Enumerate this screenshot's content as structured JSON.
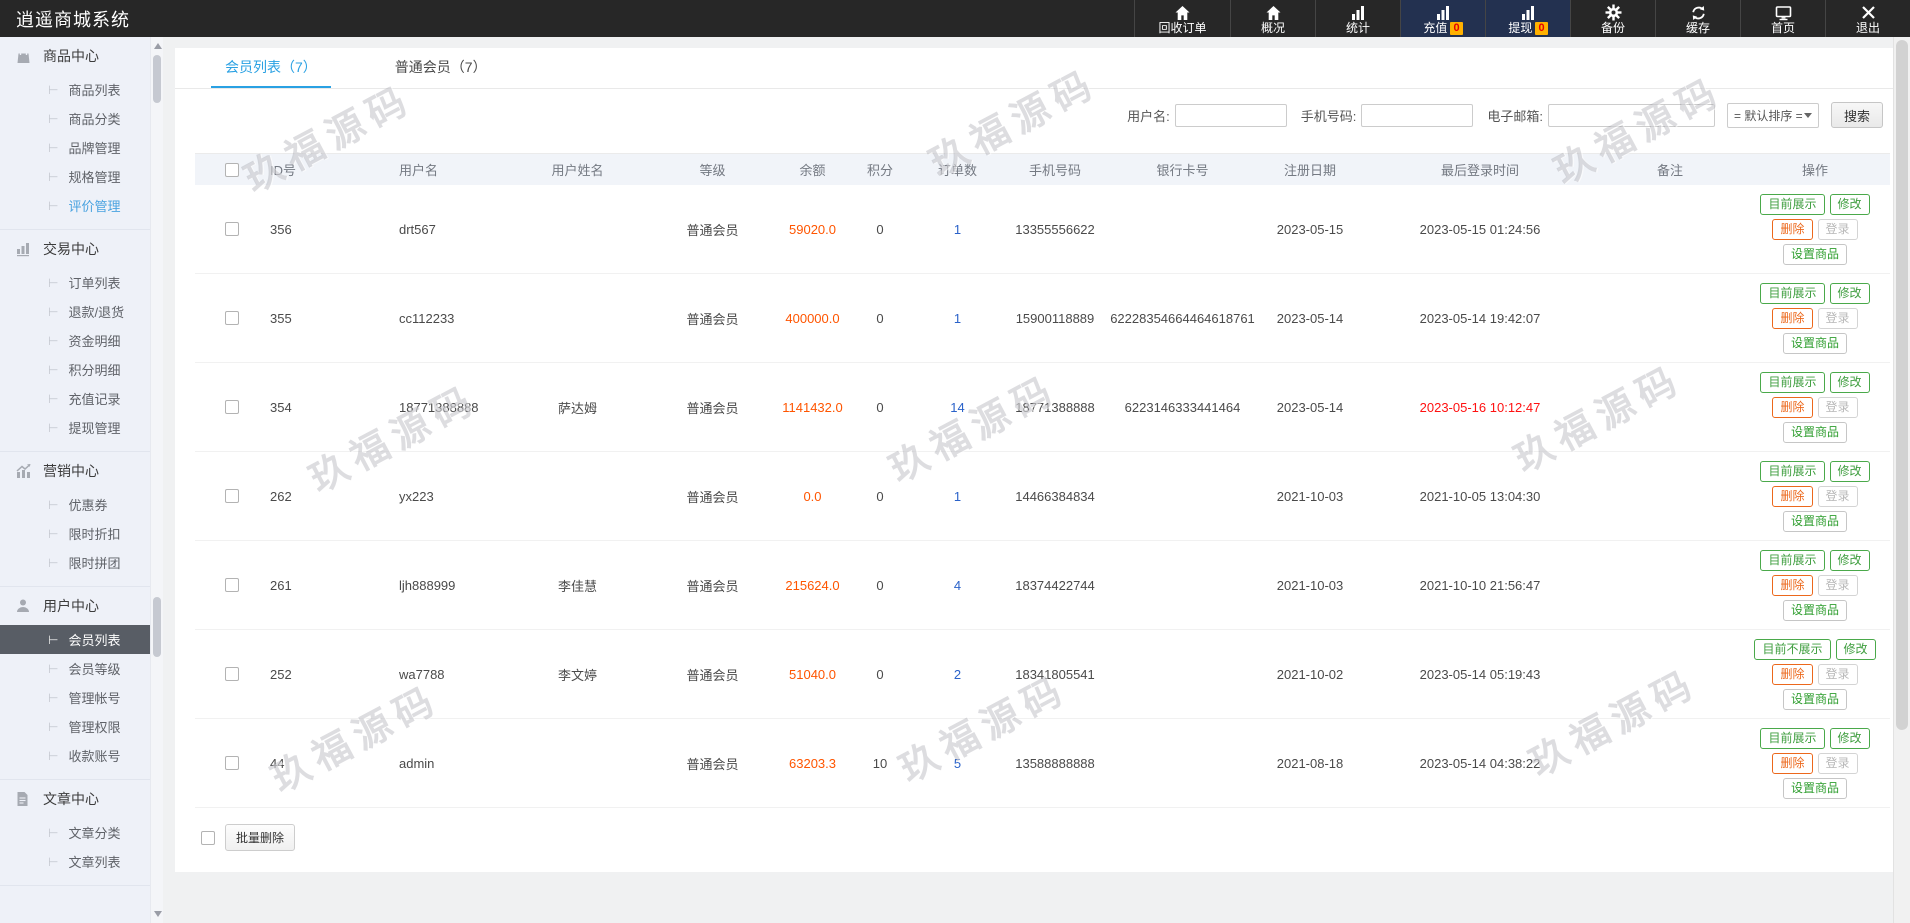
{
  "app": {
    "title": "逍遥商城系统"
  },
  "topbar": {
    "items": [
      {
        "label": "回收订单"
      },
      {
        "label": "概况"
      },
      {
        "label": "统计"
      },
      {
        "label": "充值",
        "badge": "0"
      },
      {
        "label": "提现",
        "badge": "0"
      },
      {
        "label": "备份"
      },
      {
        "label": "缓存"
      },
      {
        "label": "首页"
      },
      {
        "label": "退出"
      }
    ]
  },
  "sidebar": {
    "sections": [
      {
        "title": "商品中心",
        "items": [
          {
            "label": "商品列表"
          },
          {
            "label": "商品分类"
          },
          {
            "label": "品牌管理"
          },
          {
            "label": "规格管理"
          },
          {
            "label": "评价管理"
          }
        ]
      },
      {
        "title": "交易中心",
        "items": [
          {
            "label": "订单列表"
          },
          {
            "label": "退款/退货"
          },
          {
            "label": "资金明细"
          },
          {
            "label": "积分明细"
          },
          {
            "label": "充值记录"
          },
          {
            "label": "提现管理"
          }
        ]
      },
      {
        "title": "营销中心",
        "items": [
          {
            "label": "优惠券"
          },
          {
            "label": "限时折扣"
          },
          {
            "label": "限时拼团"
          }
        ]
      },
      {
        "title": "用户中心",
        "items": [
          {
            "label": "会员列表"
          },
          {
            "label": "会员等级"
          },
          {
            "label": "管理帐号"
          },
          {
            "label": "管理权限"
          },
          {
            "label": "收款账号"
          }
        ]
      },
      {
        "title": "文章中心",
        "items": [
          {
            "label": "文章分类"
          },
          {
            "label": "文章列表"
          }
        ]
      }
    ]
  },
  "tabs": [
    {
      "label": "会员列表（7）"
    },
    {
      "label": "普通会员（7）"
    }
  ],
  "search": {
    "username_label": "用户名:",
    "phone_label": "手机号码:",
    "email_label": "电子邮箱:",
    "sort_value": "= 默认排序 =",
    "button": "搜索"
  },
  "table": {
    "columns": [
      "ID号",
      "用户名",
      "用户姓名",
      "等级",
      "余额",
      "积分",
      "订单数",
      "手机号码",
      "银行卡号",
      "注册日期",
      "最后登录时间",
      "备注",
      "操作"
    ],
    "actions": {
      "modify": "修改",
      "delete": "删除",
      "login": "登录",
      "set_goods": "设置商品"
    },
    "rows": [
      {
        "id": "356",
        "username": "drt567",
        "realname": "",
        "level": "普通会员",
        "balance": "59020.0",
        "points": "0",
        "orders": "1",
        "phone": "13355556622",
        "bank": "",
        "reg_date": "2023-05-15",
        "last_login": "2023-05-15 01:24:56",
        "remark": "",
        "display": "目前展示"
      },
      {
        "id": "355",
        "username": "cc112233",
        "realname": "",
        "level": "普通会员",
        "balance": "400000.0",
        "points": "0",
        "orders": "1",
        "phone": "15900118889",
        "bank": "62228354664464618761",
        "reg_date": "2023-05-14",
        "last_login": "2023-05-14 19:42:07",
        "remark": "",
        "display": "目前展示"
      },
      {
        "id": "354",
        "username": "18771388888",
        "realname": "萨达姆",
        "level": "普通会员",
        "balance": "1141432.0",
        "points": "0",
        "orders": "14",
        "phone": "18771388888",
        "bank": "6223146333441464",
        "reg_date": "2023-05-14",
        "last_login": "2023-05-16 10:12:47",
        "last_login_highlight": "red",
        "remark": "",
        "display": "目前展示"
      },
      {
        "id": "262",
        "username": "yx223",
        "realname": "",
        "level": "普通会员",
        "balance": "0.0",
        "points": "0",
        "orders": "1",
        "phone": "14466384834",
        "bank": "",
        "reg_date": "2021-10-03",
        "last_login": "2021-10-05 13:04:30",
        "remark": "",
        "display": "目前展示"
      },
      {
        "id": "261",
        "username": "ljh888999",
        "realname": "李佳慧",
        "level": "普通会员",
        "balance": "215624.0",
        "points": "0",
        "orders": "4",
        "phone": "18374422744",
        "bank": "",
        "reg_date": "2021-10-03",
        "last_login": "2021-10-10 21:56:47",
        "remark": "",
        "display": "目前展示"
      },
      {
        "id": "252",
        "username": "wa7788",
        "realname": "李文婷",
        "level": "普通会员",
        "balance": "51040.0",
        "points": "0",
        "orders": "2",
        "phone": "18341805541",
        "bank": "",
        "reg_date": "2021-10-02",
        "last_login": "2023-05-14 05:19:43",
        "remark": "",
        "display": "目前不展示"
      },
      {
        "id": "44",
        "username": "admin",
        "realname": "",
        "level": "普通会员",
        "balance": "63203.3",
        "points": "10",
        "orders": "5",
        "phone": "13588888888",
        "bank": "",
        "reg_date": "2021-08-18",
        "last_login": "2023-05-14 04:38:22",
        "remark": "",
        "display": "目前展示"
      }
    ]
  },
  "footer": {
    "batch_delete": "批量删除"
  },
  "watermark": {
    "text": "玖福源码"
  },
  "colors": {
    "topbar_bg": "#272727",
    "topbar_highlight": "#233150",
    "badge_bg": "#ffb100",
    "badge_text": "#e60000",
    "sidebar_bg": "#eef1f8",
    "selected_item_bg": "#585d65",
    "accent_blue": "#2aa1e3",
    "link_blue": "#2a62c9",
    "balance_orange": "#ff5500",
    "alert_red": "#ff1111",
    "button_green": "#4aa94a",
    "button_delete_orange": "#ec681c"
  }
}
